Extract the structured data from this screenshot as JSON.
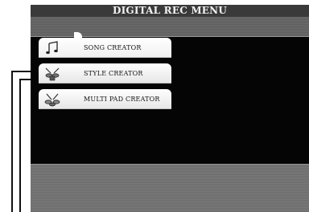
{
  "window": {
    "title": "DIGITAL REC MENU"
  },
  "menu": {
    "items": [
      {
        "label": "SONG CREATOR",
        "icon": "music-note-icon",
        "selected": true
      },
      {
        "label": "STYLE CREATOR",
        "icon": "drum-kit-icon",
        "selected": false
      },
      {
        "label": "MULTI PAD CREATOR",
        "icon": "drum-pad-icon",
        "selected": false
      }
    ]
  },
  "colors": {
    "title_bar": "#3a3a3a",
    "screen_background": "#000000",
    "tab_background": "#ffffff",
    "band": "#6b6b6b"
  }
}
